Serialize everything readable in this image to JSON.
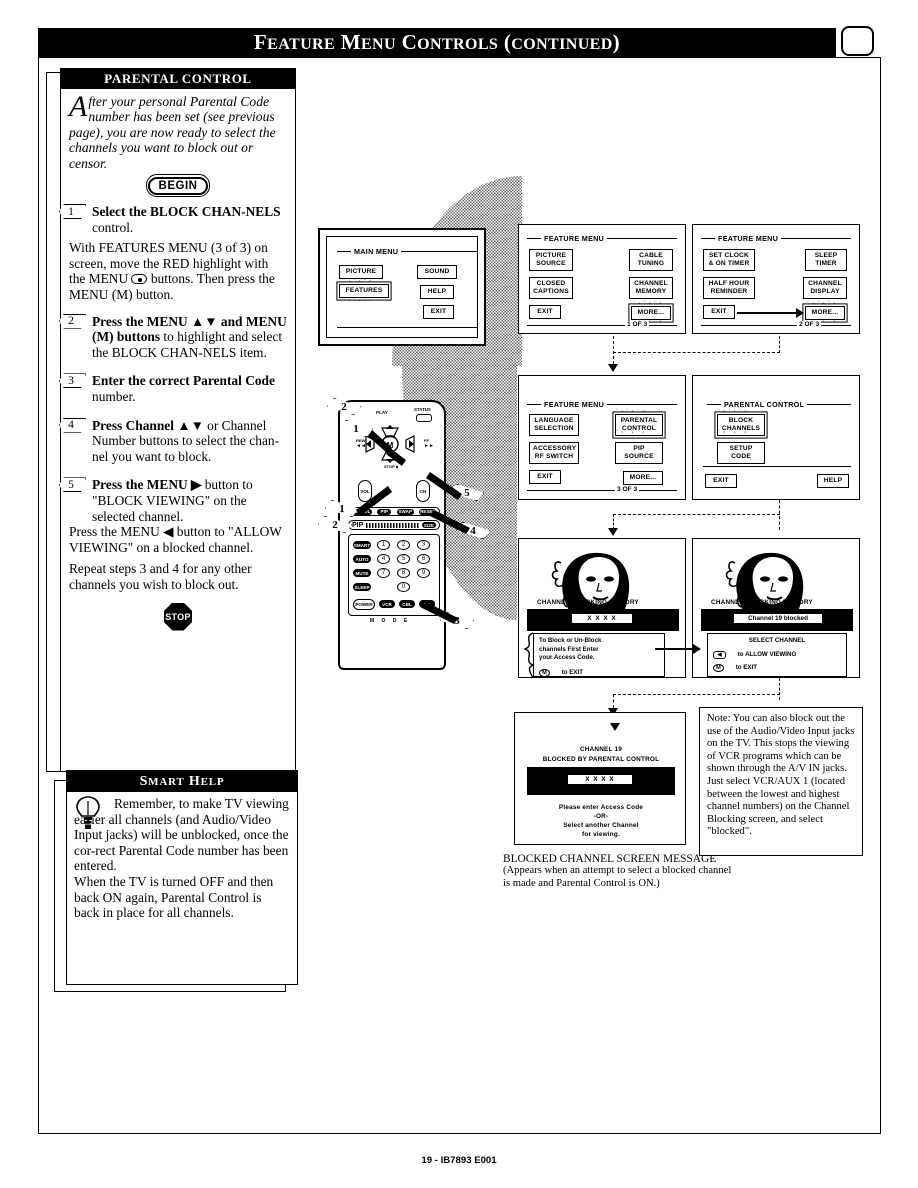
{
  "banner": {
    "title_a": "F",
    "title_b": "EATURE",
    "title_c": "M",
    "title_d": "ENU",
    "title_e": "C",
    "title_f": "ONTROLS",
    "title_g": "(",
    "title_h": "CONTINUED",
    "title_i": ")",
    "full_title": "FEATURE MENU CONTROLS (CONTINUED)"
  },
  "parental": {
    "header": "PARENTAL CONTROL",
    "dropcap": "A",
    "intro": "fter your personal Parental Code number has been set (see previous page), you are now ready to select the channels you want to block out or censor.",
    "begin_label": "BEGIN",
    "stop_label": "STOP",
    "steps": [
      {
        "num": "1",
        "bold": "Select the BLOCK CHAN-NELS",
        "rest": " control.",
        "body": "With FEATURES MENU (3 of 3) on screen, move the RED highlight with the MENU  buttons. Then press the MENU (M) button."
      },
      {
        "num": "2",
        "bold": "Press the MENU ▲▼ and MENU (M) buttons",
        "rest": " to highlight and select the BLOCK CHAN-NELS  item.",
        "body": ""
      },
      {
        "num": "3",
        "bold": "Enter the correct Parental Code",
        "rest": " number.",
        "body": ""
      },
      {
        "num": "4",
        "bold": "Press Channel ▲▼",
        "rest": " or Channel Number buttons to select the chan-nel you want to block.",
        "body": ""
      },
      {
        "num": "5",
        "bold": "Press the MENU ▶",
        "rest": " button to \"BLOCK VIEWING\" on the selected channel.",
        "body": "Press the MENU ◀ button to \"ALLOW VIEWING\" on a blocked channel.",
        "body2": "Repeat steps 3 and 4 for any other channels you wish to block out."
      }
    ]
  },
  "smart_help": {
    "header": "SMART HELP",
    "header_s": "S",
    "header_mart": "MART",
    "header_h": "H",
    "header_elp": "ELP",
    "paragraph1": "Remember, to make TV viewing easier all channels (and Audio/Video Input jacks) will be unblocked, once the cor-rect Parental Code number has been entered.",
    "paragraph2": "When the TV is turned OFF and then back ON again, Parental Control is back in place for all channels."
  },
  "main_menu_screen": {
    "title": "MAIN MENU",
    "buttons": [
      "PICTURE",
      "FEATURES",
      "SOUND",
      "HELP",
      "EXIT"
    ],
    "highlighted": "FEATURES"
  },
  "feature_menu_1": {
    "title": "FEATURE MENU",
    "left_buttons": [
      "PICTURE SOURCE",
      "CLOSED CAPTIONS",
      "EXIT"
    ],
    "right_buttons": [
      "CABLE TUNING",
      "CHANNEL MEMORY",
      "MORE..."
    ],
    "page_indicator": "1 OF 3",
    "highlighted": "MORE..."
  },
  "feature_menu_2": {
    "title": "FEATURE MENU",
    "left_buttons": [
      "SET CLOCK & ON TIMER",
      "HALF HOUR REMINDER",
      "EXIT"
    ],
    "right_buttons": [
      "SLEEP TIMER",
      "CHANNEL DISPLAY",
      "MORE..."
    ],
    "page_indicator": "2 OF 3",
    "highlighted": "MORE..."
  },
  "feature_menu_3": {
    "title": "FEATURE MENU",
    "left_buttons": [
      "LANGUAGE SELECTION",
      "ACCESSORY RF SWITCH",
      "EXIT"
    ],
    "right_buttons": [
      "PARENTAL CONTROL",
      "PIP SOURCE",
      "MORE..."
    ],
    "page_indicator": "3 OF 3",
    "highlighted": "PARENTAL CONTROL"
  },
  "parental_control_screen": {
    "title": "PARENTAL CONTROL",
    "buttons": [
      "BLOCK CHANNELS",
      "SETUP CODE"
    ],
    "exit_label": "EXIT",
    "help_label": "HELP",
    "highlighted": "BLOCK CHANNELS"
  },
  "blocking_screen_left": {
    "caption": "CHANNEL BLOCKING MEMORY",
    "code_display": "X X X X",
    "message_line1": "To Block or Un-Block",
    "message_line2": "channels First Enter",
    "message_line3": "your Access Code.",
    "exit_button": "M",
    "exit_label": "to EXIT"
  },
  "blocking_screen_right": {
    "caption": "CHANNEL BLOCKING MEMORY",
    "status": "Channel 19 blocked",
    "message_title": "SELECT CHANNEL",
    "allow_button": "◀",
    "allow_label": "to ALLOW VIEWING",
    "exit_button": "M",
    "exit_label": "to EXIT"
  },
  "blocked_screen": {
    "line1": "CHANNEL 19",
    "line2": "BLOCKED BY PARENTAL CONTROL",
    "code_display": "X X X X",
    "msg1": "Please enter Access Code",
    "msg2": "-OR-",
    "msg3": "Select another Channel",
    "msg4": "for viewing."
  },
  "blocked_caption": {
    "heading": "BLOCKED CHANNEL SCREEN MESSAGE",
    "body": "(Appears when an attempt to select a blocked channel is made and Parental Control is ON.)"
  },
  "note": {
    "text": "Note: You can also block out  the use of the Audio/Video Input jacks on the TV. This stops the viewing of VCR programs which can be shown through the A/V IN jacks. Just select VCR/AUX 1 (located between the lowest and highest channel numbers) on the Channel Blocking screen, and select \"blocked\"."
  },
  "remote": {
    "status_label": "STATUS",
    "play_label": "PLAY",
    "rew_label": "REW",
    "ff_label": "FF",
    "menu_center": "M",
    "menu_small": "MENU",
    "stop_label": "STOP",
    "vol_label": "VOL",
    "ch_label": "CH",
    "row_keys": [
      "CH/VOL",
      "PIP",
      "SWAP",
      "RESET"
    ],
    "pip_label": "PIP",
    "pip_size": "SIZE",
    "side_keys": [
      "SMART",
      "AUTO",
      "MUTE",
      "SLEEP"
    ],
    "numbers": [
      "1",
      "2",
      "3",
      "4",
      "5",
      "6",
      "7",
      "8",
      "9",
      "0"
    ],
    "power_label": "POWER",
    "mode_keys": [
      "VCR",
      "CBL",
      "TV"
    ],
    "mode_label": "M O D E",
    "callouts": [
      "1",
      "2",
      "3",
      "4",
      "5"
    ]
  },
  "footer": {
    "text": "19 - IB7893 E001"
  }
}
